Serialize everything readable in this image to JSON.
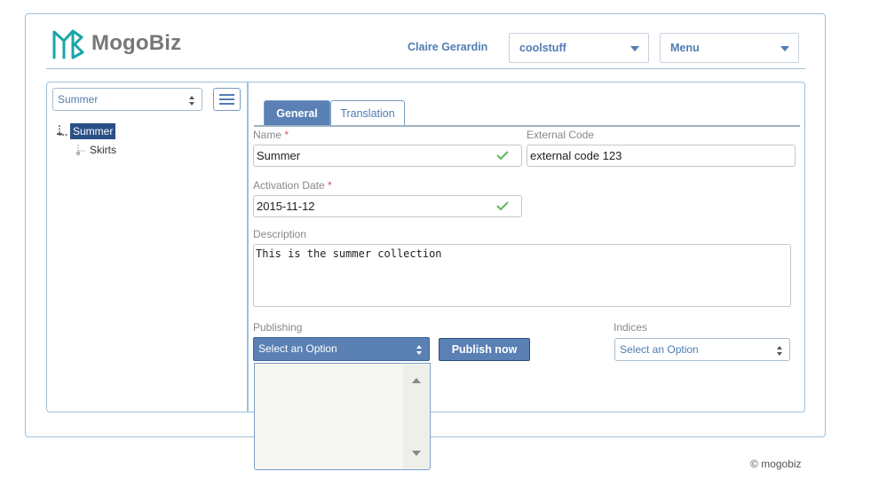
{
  "app": {
    "name": "MogoBiz"
  },
  "header": {
    "user_name": "Claire Gerardin",
    "store_select": {
      "value": "coolstuff"
    },
    "menu_select": {
      "value": "Menu"
    }
  },
  "sidebar": {
    "catalog_select": {
      "value": "Summer"
    },
    "tree": {
      "root": {
        "label": "Summer",
        "selected": true
      },
      "children": [
        {
          "label": "Skirts"
        }
      ]
    }
  },
  "tabs": [
    {
      "label": "General",
      "active": true
    },
    {
      "label": "Translation",
      "active": false
    }
  ],
  "form": {
    "name": {
      "label": "Name",
      "required_mark": "*",
      "value": "Summer"
    },
    "external_code": {
      "label": "External Code",
      "value": "external code 123"
    },
    "activation_date": {
      "label": "Activation Date",
      "required_mark": "*",
      "value": "2015-11-12"
    },
    "description": {
      "label": "Description",
      "value": "This is the summer collection"
    },
    "publishing": {
      "label": "Publishing",
      "value": "Select an Option"
    },
    "publish_button": "Publish now",
    "indices": {
      "label": "Indices",
      "value": "Select an Option"
    }
  },
  "footer": {
    "text": "© mogobiz"
  },
  "colors": {
    "accent": "#5a80b4",
    "link": "#4f7db3",
    "border": "#9ec2dc",
    "logo": "#1aa5a8",
    "valid": "#5cb85c",
    "required": "#d9534f"
  }
}
